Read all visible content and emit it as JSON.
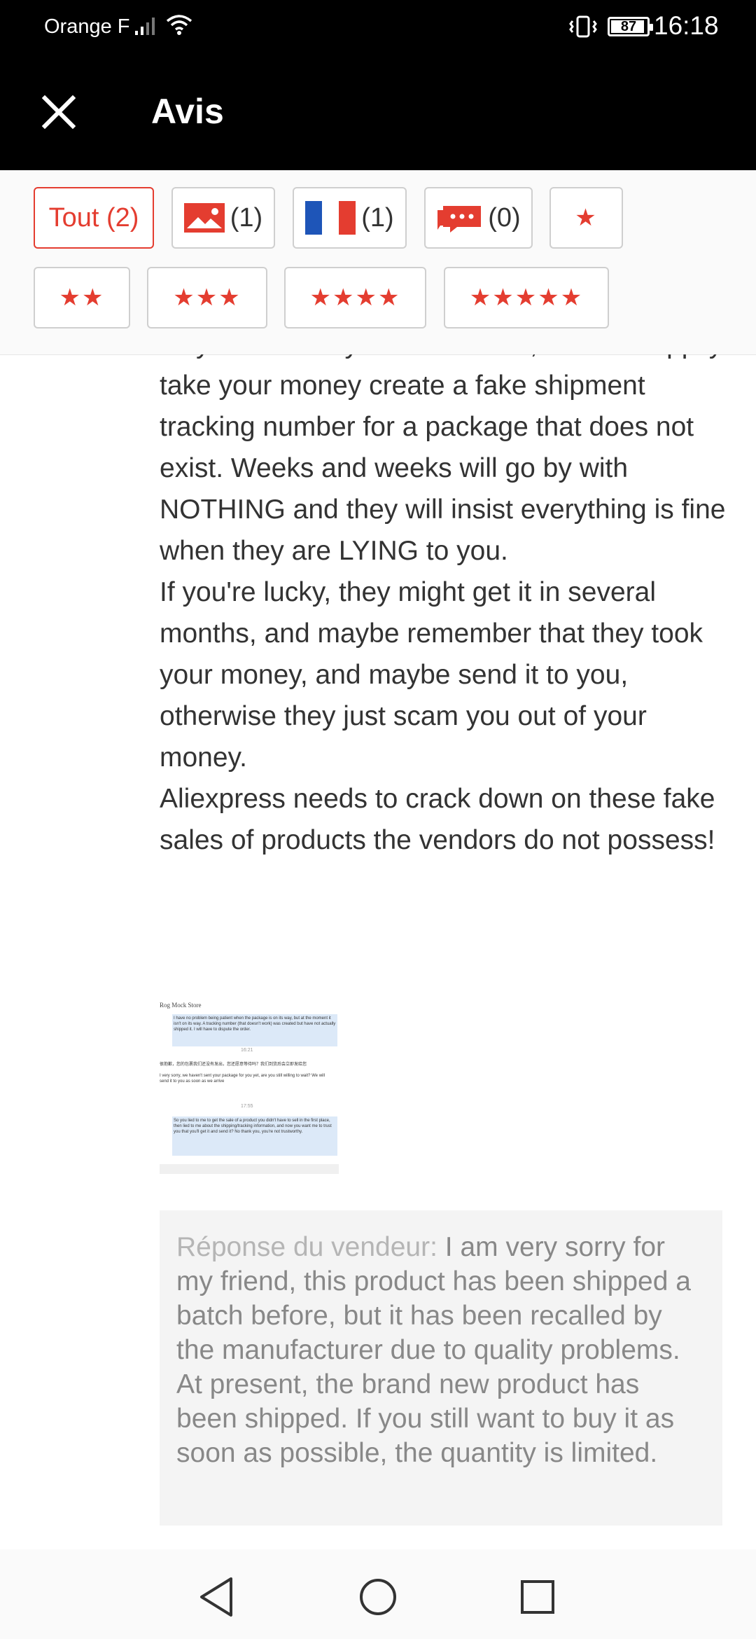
{
  "status_bar": {
    "carrier": "Orange F",
    "battery_level": "87",
    "time": "16:18"
  },
  "header": {
    "title": "Avis",
    "close_icon": "close-icon"
  },
  "filters": {
    "all_label": "Tout (2)",
    "photo_count": "(1)",
    "country_count": "(1)",
    "comment_count": "(0)",
    "star_filters": [
      "★",
      "★★",
      "★★★",
      "★★★★",
      "★★★★★"
    ]
  },
  "review": {
    "paragraphs": [
      "only means they do not have it, but will happily take your money create a fake shipment tracking number for a package that does not exist. Weeks and weeks will go by with NOTHING and they will insist everything is fine when they are LYING to you.",
      "If you're lucky, they might get it in several months, and maybe remember that they took your money, and maybe send it to you, otherwise they just scam you out of your money.",
      "Aliexpress needs to crack down on these fake sales of products the vendors do not possess!"
    ],
    "image": {
      "header": "Rog Mock Store",
      "msg1": "I have no problem being patient when the package is on its way, but at the moment it isn't on its way. A tracking number (that doesn't work) was created but have not actually shipped it. I will have to dispute the order.",
      "time1": "16:21",
      "msg2": "很抱歉，您的包裹我们还没有发出，您还愿意等待吗？我们到货后会立即发给您",
      "msg3": "I very sorry, we haven't sent your package for you yet, are you still willing to wait? We will send it to you as soon as we arrive",
      "time2": "17:55",
      "msg4": "So you lied to me to get the sale of a product you didn't have to sell in the first place, then lied to me about the shipping/tracking information, and now you want me to trust you that you'll get it and send it? No thank you, you're not trustworthy."
    }
  },
  "seller_reply": {
    "label": "Réponse du vendeur: ",
    "text": "I am very sorry for my friend, this product has been shipped a batch before, but it has been recalled by the manufacturer due to quality problems. At present, the brand new product has been shipped. If you still want to buy it as soon as possible, the quantity is limited."
  },
  "colors": {
    "accent": "#e43d30",
    "header_bg": "#000000"
  }
}
